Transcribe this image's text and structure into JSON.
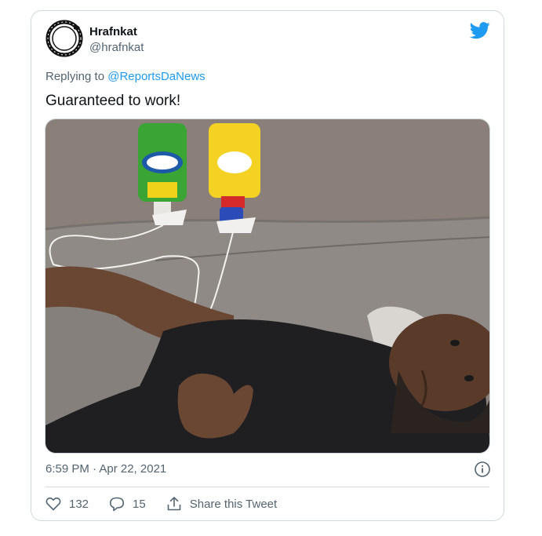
{
  "tweet": {
    "author": {
      "name": "Hrafnkat",
      "handle": "@hrafnkat",
      "avatar_icon": "ouroboros-icon"
    },
    "brand_icon": "twitter-bird-icon",
    "brand_color": "#1d9bf0",
    "replying_to": {
      "prefix": "Replying to",
      "mention": "@ReportsDaNews"
    },
    "text": "Guaranteed to work!",
    "timestamp": "6:59 PM · Apr 22, 2021",
    "info_icon": "info-icon",
    "actions": {
      "like_count": "132",
      "reply_count": "15",
      "share_label": "Share this Tweet"
    }
  }
}
